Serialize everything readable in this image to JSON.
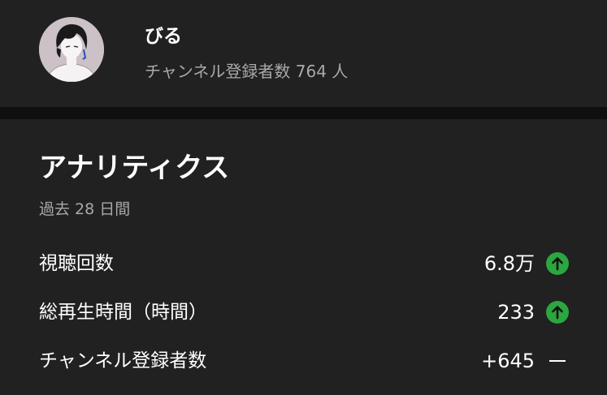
{
  "channel": {
    "name": "びる",
    "subscribers_text": "チャンネル登録者数 764 人"
  },
  "analytics": {
    "title": "アナリティクス",
    "period": "過去 28 日間",
    "metrics": [
      {
        "label": "視聴回数",
        "value": "6.8万",
        "trend": "up"
      },
      {
        "label": "総再生時間（時間）",
        "value": "233",
        "trend": "up"
      },
      {
        "label": "チャンネル登録者数",
        "value": "+645",
        "trend": "flat"
      }
    ]
  },
  "colors": {
    "background": "#212121",
    "divider": "#0f0f0f",
    "secondary_text": "#a9a9a9",
    "trend_up": "#2ba640"
  },
  "icons": {
    "trend_up": "arrow-up-circle-icon",
    "trend_flat": "dash-icon",
    "avatar": "avatar-illustration"
  }
}
